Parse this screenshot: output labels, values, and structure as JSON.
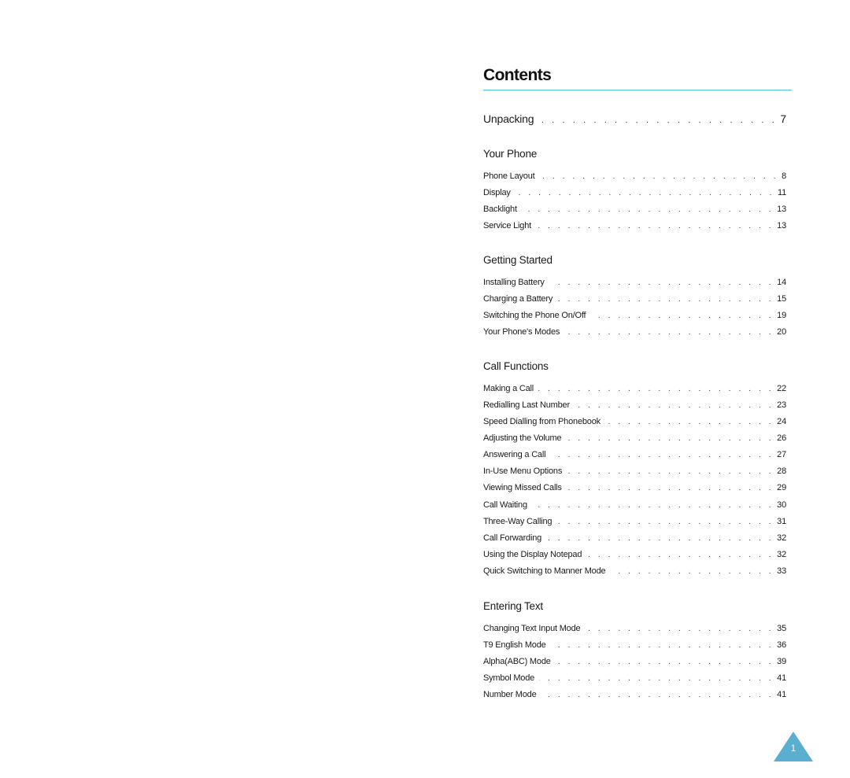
{
  "title": "Contents",
  "accent_color": "#4cc4ee",
  "badge_color": "#5aaed0",
  "top_entry": {
    "label": "Unpacking",
    "page": "7"
  },
  "sections": [
    {
      "heading": "Your Phone",
      "entries": [
        {
          "label": "Phone Layout",
          "page": "8"
        },
        {
          "label": "Display",
          "page": "11"
        },
        {
          "label": "Backlight",
          "page": "13"
        },
        {
          "label": "Service Light",
          "page": "13"
        }
      ]
    },
    {
      "heading": "Getting Started",
      "entries": [
        {
          "label": "Installing Battery",
          "page": "14"
        },
        {
          "label": "Charging a Battery",
          "page": "15"
        },
        {
          "label": "Switching the Phone On/Off",
          "page": "19"
        },
        {
          "label": "Your Phone's Modes",
          "page": "20"
        }
      ]
    },
    {
      "heading": "Call Functions",
      "entries": [
        {
          "label": "Making a Call",
          "page": "22"
        },
        {
          "label": "Redialling Last Number",
          "page": "23"
        },
        {
          "label": "Speed Dialling from Phonebook",
          "page": "24"
        },
        {
          "label": "Adjusting the Volume",
          "page": "26"
        },
        {
          "label": "Answering a Call",
          "page": "27"
        },
        {
          "label": "In-Use Menu Options",
          "page": "28"
        },
        {
          "label": "Viewing Missed Calls",
          "page": "29"
        },
        {
          "label": "Call Waiting",
          "page": "30"
        },
        {
          "label": "Three-Way Calling",
          "page": "31"
        },
        {
          "label": "Call Forwarding",
          "page": "32"
        },
        {
          "label": "Using the Display Notepad",
          "page": "32"
        },
        {
          "label": "Quick Switching to Manner Mode",
          "page": "33"
        }
      ]
    },
    {
      "heading": "Entering Text",
      "entries": [
        {
          "label": "Changing Text Input Mode",
          "page": "35"
        },
        {
          "label": "T9 English Mode",
          "page": "36"
        },
        {
          "label": "Alpha(ABC) Mode",
          "page": "39"
        },
        {
          "label": "Symbol Mode",
          "page": "41"
        },
        {
          "label": "Number Mode",
          "page": "41"
        }
      ]
    }
  ],
  "leader_dots": ". . . . . . . . . . . . . . . . . . . . . . . . . . . . . . . . . . . . . . . . . . . . . . . . . . . . . . . . . . . .",
  "page_number": "1"
}
